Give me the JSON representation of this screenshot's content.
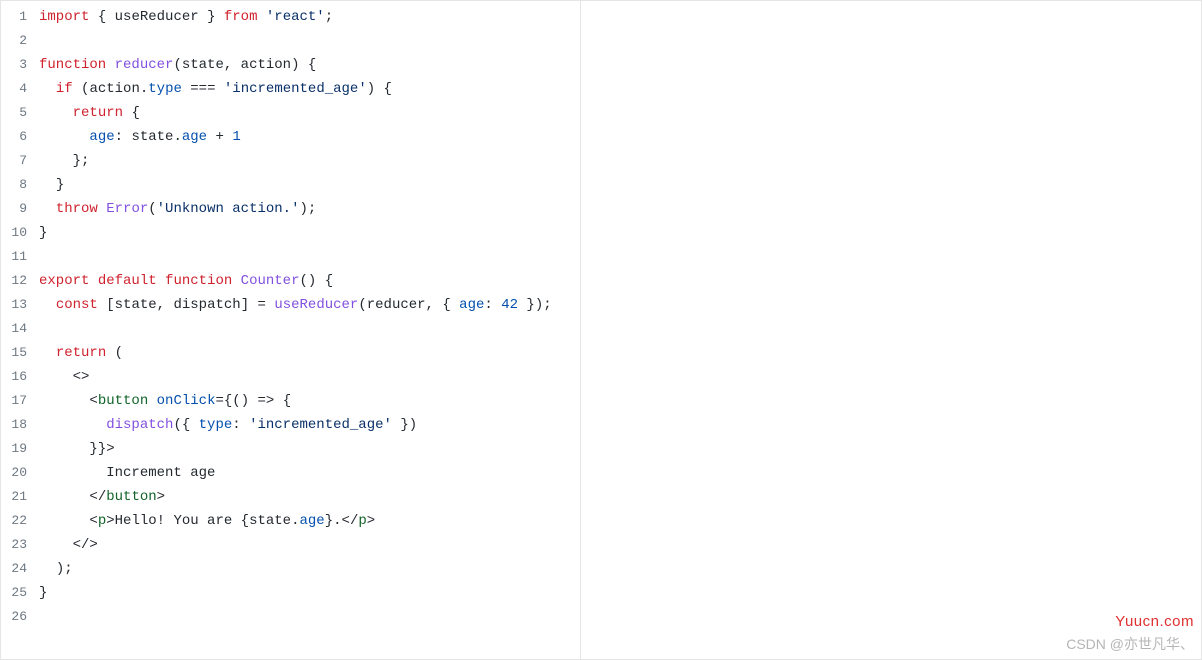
{
  "watermarks": {
    "top": "Yuucn.com",
    "bottom": "CSDN @亦世凡华、"
  },
  "lines": [
    {
      "n": 1,
      "tokens": [
        {
          "c": "kw",
          "t": "import"
        },
        {
          "c": "pl",
          "t": " "
        },
        {
          "c": "punc",
          "t": "{"
        },
        {
          "c": "pl",
          "t": " useReducer "
        },
        {
          "c": "punc",
          "t": "}"
        },
        {
          "c": "pl",
          "t": " "
        },
        {
          "c": "kw",
          "t": "from"
        },
        {
          "c": "pl",
          "t": " "
        },
        {
          "c": "str",
          "t": "'react'"
        },
        {
          "c": "punc",
          "t": ";"
        }
      ]
    },
    {
      "n": 2,
      "tokens": []
    },
    {
      "n": 3,
      "tokens": [
        {
          "c": "kw",
          "t": "function"
        },
        {
          "c": "pl",
          "t": " "
        },
        {
          "c": "fn",
          "t": "reducer"
        },
        {
          "c": "punc",
          "t": "("
        },
        {
          "c": "pl",
          "t": "state"
        },
        {
          "c": "punc",
          "t": ","
        },
        {
          "c": "pl",
          "t": " action"
        },
        {
          "c": "punc",
          "t": ")"
        },
        {
          "c": "pl",
          "t": " "
        },
        {
          "c": "punc",
          "t": "{"
        }
      ]
    },
    {
      "n": 4,
      "tokens": [
        {
          "c": "pl",
          "t": "  "
        },
        {
          "c": "kw",
          "t": "if"
        },
        {
          "c": "pl",
          "t": " "
        },
        {
          "c": "punc",
          "t": "("
        },
        {
          "c": "pl",
          "t": "action"
        },
        {
          "c": "punc",
          "t": "."
        },
        {
          "c": "id",
          "t": "type"
        },
        {
          "c": "pl",
          "t": " "
        },
        {
          "c": "op",
          "t": "==="
        },
        {
          "c": "pl",
          "t": " "
        },
        {
          "c": "str",
          "t": "'incremented_age'"
        },
        {
          "c": "punc",
          "t": ")"
        },
        {
          "c": "pl",
          "t": " "
        },
        {
          "c": "punc",
          "t": "{"
        }
      ]
    },
    {
      "n": 5,
      "tokens": [
        {
          "c": "pl",
          "t": "    "
        },
        {
          "c": "kw",
          "t": "return"
        },
        {
          "c": "pl",
          "t": " "
        },
        {
          "c": "punc",
          "t": "{"
        }
      ]
    },
    {
      "n": 6,
      "tokens": [
        {
          "c": "pl",
          "t": "      "
        },
        {
          "c": "id",
          "t": "age"
        },
        {
          "c": "punc",
          "t": ":"
        },
        {
          "c": "pl",
          "t": " state"
        },
        {
          "c": "punc",
          "t": "."
        },
        {
          "c": "id",
          "t": "age"
        },
        {
          "c": "pl",
          "t": " "
        },
        {
          "c": "op",
          "t": "+"
        },
        {
          "c": "pl",
          "t": " "
        },
        {
          "c": "num",
          "t": "1"
        }
      ]
    },
    {
      "n": 7,
      "tokens": [
        {
          "c": "pl",
          "t": "    "
        },
        {
          "c": "punc",
          "t": "}"
        },
        {
          "c": "punc",
          "t": ";"
        }
      ]
    },
    {
      "n": 8,
      "tokens": [
        {
          "c": "pl",
          "t": "  "
        },
        {
          "c": "punc",
          "t": "}"
        }
      ]
    },
    {
      "n": 9,
      "tokens": [
        {
          "c": "pl",
          "t": "  "
        },
        {
          "c": "kw",
          "t": "throw"
        },
        {
          "c": "pl",
          "t": " "
        },
        {
          "c": "fn",
          "t": "Error"
        },
        {
          "c": "punc",
          "t": "("
        },
        {
          "c": "str",
          "t": "'Unknown action.'"
        },
        {
          "c": "punc",
          "t": ")"
        },
        {
          "c": "punc",
          "t": ";"
        }
      ]
    },
    {
      "n": 10,
      "tokens": [
        {
          "c": "punc",
          "t": "}"
        }
      ]
    },
    {
      "n": 11,
      "tokens": []
    },
    {
      "n": 12,
      "tokens": [
        {
          "c": "kw",
          "t": "export"
        },
        {
          "c": "pl",
          "t": " "
        },
        {
          "c": "kw",
          "t": "default"
        },
        {
          "c": "pl",
          "t": " "
        },
        {
          "c": "kw",
          "t": "function"
        },
        {
          "c": "pl",
          "t": " "
        },
        {
          "c": "fn",
          "t": "Counter"
        },
        {
          "c": "punc",
          "t": "("
        },
        {
          "c": "punc",
          "t": ")"
        },
        {
          "c": "pl",
          "t": " "
        },
        {
          "c": "punc",
          "t": "{"
        }
      ]
    },
    {
      "n": 13,
      "tokens": [
        {
          "c": "pl",
          "t": "  "
        },
        {
          "c": "kw",
          "t": "const"
        },
        {
          "c": "pl",
          "t": " "
        },
        {
          "c": "punc",
          "t": "["
        },
        {
          "c": "pl",
          "t": "state"
        },
        {
          "c": "punc",
          "t": ","
        },
        {
          "c": "pl",
          "t": " dispatch"
        },
        {
          "c": "punc",
          "t": "]"
        },
        {
          "c": "pl",
          "t": " "
        },
        {
          "c": "op",
          "t": "="
        },
        {
          "c": "pl",
          "t": " "
        },
        {
          "c": "fn",
          "t": "useReducer"
        },
        {
          "c": "punc",
          "t": "("
        },
        {
          "c": "pl",
          "t": "reducer"
        },
        {
          "c": "punc",
          "t": ","
        },
        {
          "c": "pl",
          "t": " "
        },
        {
          "c": "punc",
          "t": "{"
        },
        {
          "c": "pl",
          "t": " "
        },
        {
          "c": "id",
          "t": "age"
        },
        {
          "c": "punc",
          "t": ":"
        },
        {
          "c": "pl",
          "t": " "
        },
        {
          "c": "num",
          "t": "42"
        },
        {
          "c": "pl",
          "t": " "
        },
        {
          "c": "punc",
          "t": "}"
        },
        {
          "c": "punc",
          "t": ")"
        },
        {
          "c": "punc",
          "t": ";"
        }
      ]
    },
    {
      "n": 14,
      "tokens": []
    },
    {
      "n": 15,
      "tokens": [
        {
          "c": "pl",
          "t": "  "
        },
        {
          "c": "kw",
          "t": "return"
        },
        {
          "c": "pl",
          "t": " "
        },
        {
          "c": "punc",
          "t": "("
        }
      ]
    },
    {
      "n": 16,
      "tokens": [
        {
          "c": "pl",
          "t": "    "
        },
        {
          "c": "punc",
          "t": "<"
        },
        {
          "c": "punc",
          "t": ">"
        }
      ]
    },
    {
      "n": 17,
      "tokens": [
        {
          "c": "pl",
          "t": "      "
        },
        {
          "c": "punc",
          "t": "<"
        },
        {
          "c": "tag",
          "t": "button"
        },
        {
          "c": "pl",
          "t": " "
        },
        {
          "c": "attr",
          "t": "onClick"
        },
        {
          "c": "op",
          "t": "="
        },
        {
          "c": "punc",
          "t": "{"
        },
        {
          "c": "punc",
          "t": "("
        },
        {
          "c": "punc",
          "t": ")"
        },
        {
          "c": "pl",
          "t": " "
        },
        {
          "c": "op",
          "t": "=>"
        },
        {
          "c": "pl",
          "t": " "
        },
        {
          "c": "punc",
          "t": "{"
        }
      ]
    },
    {
      "n": 18,
      "tokens": [
        {
          "c": "pl",
          "t": "        "
        },
        {
          "c": "fn",
          "t": "dispatch"
        },
        {
          "c": "punc",
          "t": "("
        },
        {
          "c": "punc",
          "t": "{"
        },
        {
          "c": "pl",
          "t": " "
        },
        {
          "c": "id",
          "t": "type"
        },
        {
          "c": "punc",
          "t": ":"
        },
        {
          "c": "pl",
          "t": " "
        },
        {
          "c": "str",
          "t": "'incremented_age'"
        },
        {
          "c": "pl",
          "t": " "
        },
        {
          "c": "punc",
          "t": "}"
        },
        {
          "c": "punc",
          "t": ")"
        }
      ]
    },
    {
      "n": 19,
      "tokens": [
        {
          "c": "pl",
          "t": "      "
        },
        {
          "c": "punc",
          "t": "}"
        },
        {
          "c": "punc",
          "t": "}"
        },
        {
          "c": "punc",
          "t": ">"
        }
      ]
    },
    {
      "n": 20,
      "tokens": [
        {
          "c": "pl",
          "t": "        Increment age"
        }
      ]
    },
    {
      "n": 21,
      "tokens": [
        {
          "c": "pl",
          "t": "      "
        },
        {
          "c": "punc",
          "t": "<"
        },
        {
          "c": "punc",
          "t": "/"
        },
        {
          "c": "tag",
          "t": "button"
        },
        {
          "c": "punc",
          "t": ">"
        }
      ]
    },
    {
      "n": 22,
      "tokens": [
        {
          "c": "pl",
          "t": "      "
        },
        {
          "c": "punc",
          "t": "<"
        },
        {
          "c": "tag",
          "t": "p"
        },
        {
          "c": "punc",
          "t": ">"
        },
        {
          "c": "pl",
          "t": "Hello! You are "
        },
        {
          "c": "punc",
          "t": "{"
        },
        {
          "c": "pl",
          "t": "state"
        },
        {
          "c": "punc",
          "t": "."
        },
        {
          "c": "id",
          "t": "age"
        },
        {
          "c": "punc",
          "t": "}"
        },
        {
          "c": "pl",
          "t": "."
        },
        {
          "c": "punc",
          "t": "<"
        },
        {
          "c": "punc",
          "t": "/"
        },
        {
          "c": "tag",
          "t": "p"
        },
        {
          "c": "punc",
          "t": ">"
        }
      ]
    },
    {
      "n": 23,
      "tokens": [
        {
          "c": "pl",
          "t": "    "
        },
        {
          "c": "punc",
          "t": "<"
        },
        {
          "c": "punc",
          "t": "/"
        },
        {
          "c": "punc",
          "t": ">"
        }
      ]
    },
    {
      "n": 24,
      "tokens": [
        {
          "c": "pl",
          "t": "  "
        },
        {
          "c": "punc",
          "t": ")"
        },
        {
          "c": "punc",
          "t": ";"
        }
      ]
    },
    {
      "n": 25,
      "tokens": [
        {
          "c": "punc",
          "t": "}"
        }
      ]
    },
    {
      "n": 26,
      "tokens": []
    }
  ]
}
